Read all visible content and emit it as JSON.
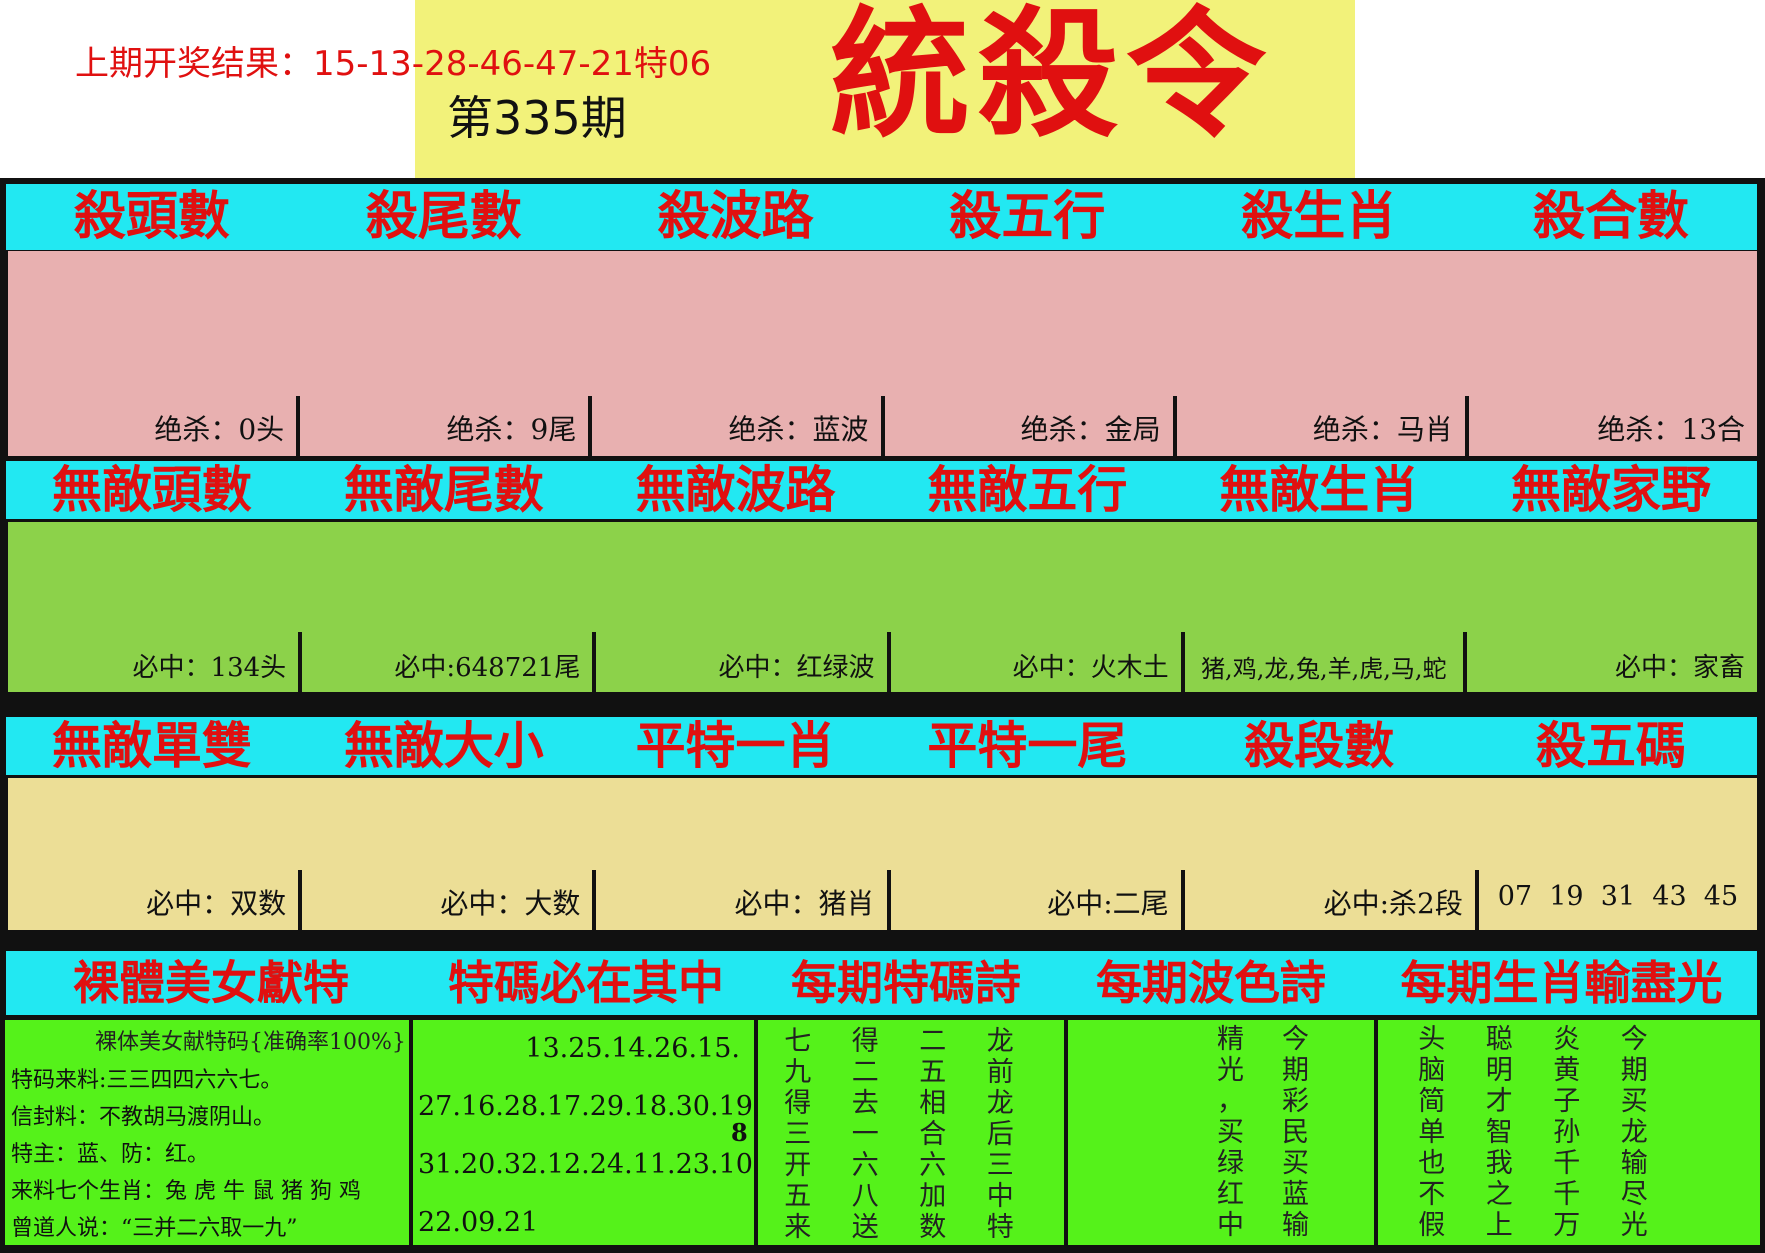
{
  "header": {
    "title": "統殺令",
    "last_result": "上期开奖结果：15-13-28-46-47-21特06",
    "issue": "第335期"
  },
  "row1": {
    "headers": [
      "殺頭數",
      "殺尾數",
      "殺波路",
      "殺五行",
      "殺生肖",
      "殺合數"
    ],
    "values": [
      "绝杀：0头",
      "绝杀：9尾",
      "绝杀：蓝波",
      "绝杀：金局",
      "绝杀：马肖",
      "绝杀：13合"
    ]
  },
  "row2": {
    "headers": [
      "無敵頭數",
      "無敵尾數",
      "無敵波路",
      "無敵五行",
      "無敵生肖",
      "無敵家野"
    ],
    "values": [
      "必中：134头",
      "必中:648721尾",
      "必中：红绿波",
      "必中：火木土",
      "猪,鸡,龙,兔,羊,虎,马,蛇",
      "必中：家畜"
    ]
  },
  "row3": {
    "headers": [
      "無敵單雙",
      "無敵大小",
      "平特一肖",
      "平特一尾",
      "殺段數",
      "殺五碼"
    ],
    "values": [
      "必中：双数",
      "必中：大数",
      "必中：猪肖",
      "必中:二尾",
      "必中:杀2段",
      "07  19  31  43  45"
    ]
  },
  "row4": {
    "headers": [
      "裸體美女獻特",
      "特碼必在其中",
      "每期特碼詩",
      "每期波色詩",
      "每期生肖輸盡光"
    ]
  },
  "beauty": {
    "title": "裸体美女献特码{准确率100%}",
    "lines": [
      "特码来料:三三四四六六七。",
      "信封料：不教胡马渡阴山。",
      "特主：蓝、防：红。",
      "来料七个生肖：兔 虎 牛 鼠 猪 狗 鸡",
      "曾道人说：“三并二六取一九”"
    ]
  },
  "numbers": {
    "lines": [
      "13.25.14.26.15.",
      "27.16.28.17.29.18.30.19.",
      "31.20.32.12.24.11.23.10.",
      "22.09.21"
    ],
    "mark": "8"
  },
  "poem_special": [
    "七",
    "得",
    "二",
    "龙",
    "九",
    "二",
    "五",
    "前",
    "得",
    "去",
    "相",
    "龙",
    "三",
    "一",
    "合",
    "后",
    "开",
    "六",
    "六",
    "三",
    "五",
    "八",
    "加",
    "中",
    "来",
    "送",
    "数",
    "特"
  ],
  "poem_wave": [
    "精",
    "今",
    "光",
    "期",
    "，",
    "彩",
    "买",
    "民",
    "绿",
    "买",
    "红",
    "蓝",
    "中",
    "输"
  ],
  "poem_zodiac": [
    "头",
    "聪",
    "炎",
    "今",
    "脑",
    "明",
    "黄",
    "期",
    "简",
    "才",
    "子",
    "买",
    "单",
    "智",
    "孙",
    "龙",
    "也",
    "我",
    "千",
    "输",
    "不",
    "之",
    "千",
    "尽",
    "假",
    "上",
    "万",
    "光"
  ],
  "colors": {
    "cyan": "#22e8f2",
    "red": "#e01010",
    "pink": "#e8b0b0",
    "green": "#8cd24a",
    "yellow": "#ecde96",
    "bright_green": "#55f21a"
  }
}
